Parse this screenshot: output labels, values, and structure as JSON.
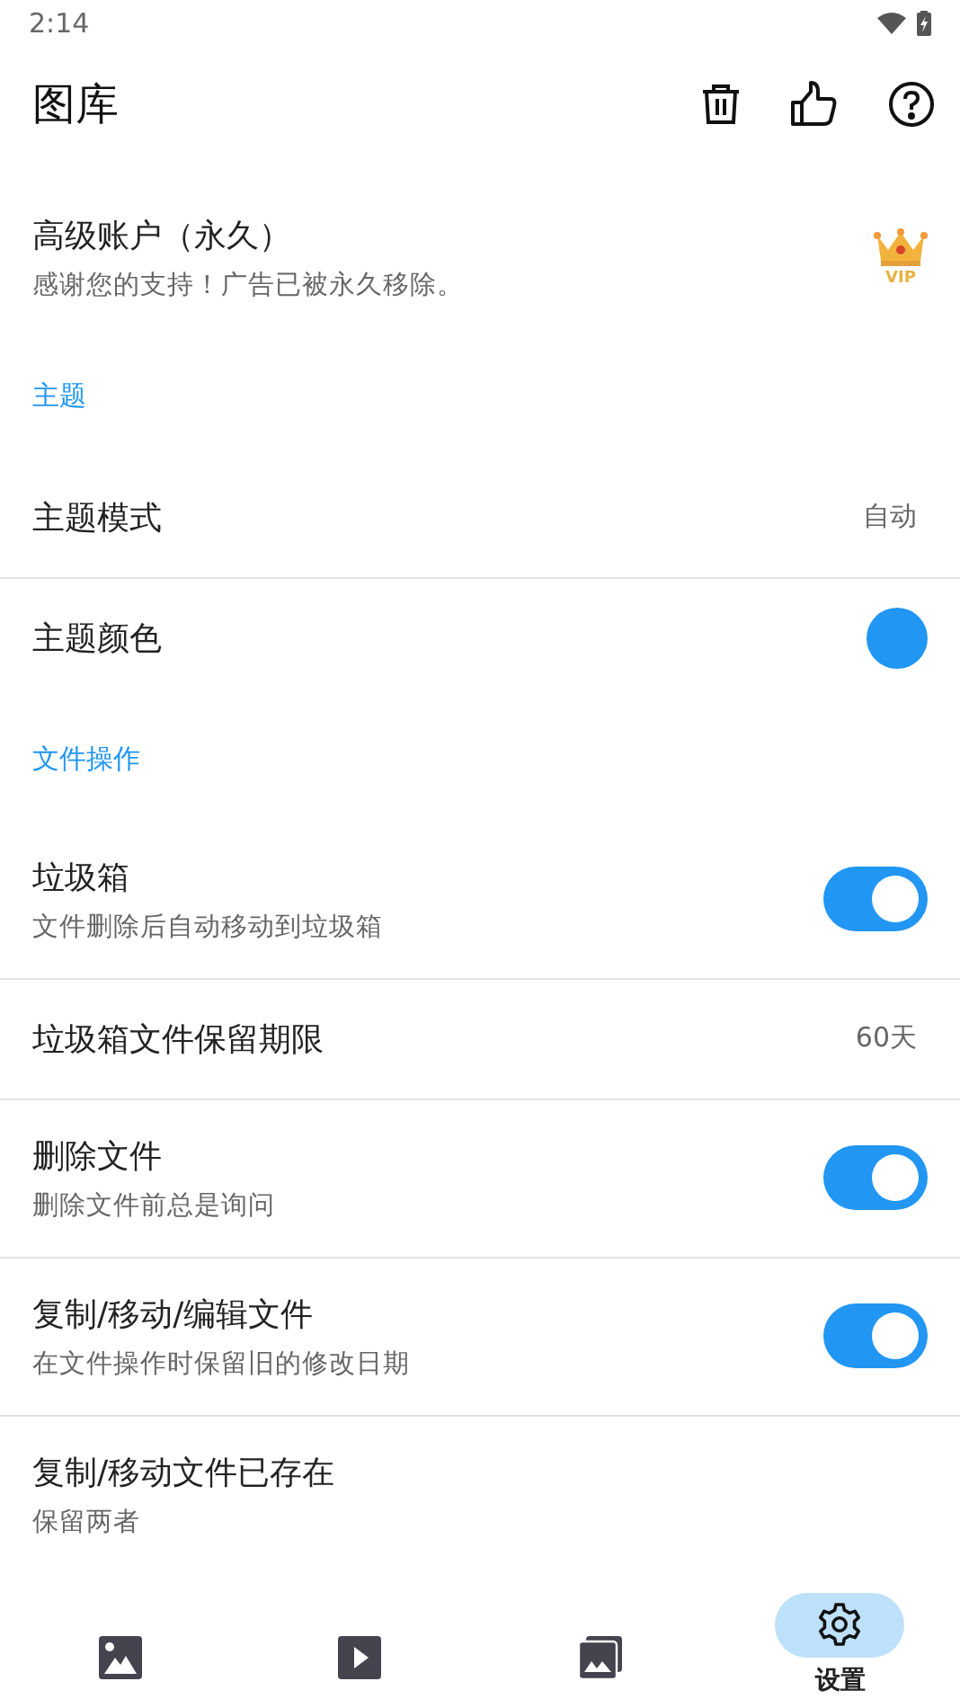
{
  "status_bar": {
    "time": "2:14"
  },
  "app_bar": {
    "title": "图库"
  },
  "rows": [
    {
      "kind": "premium",
      "title": "高级账户（永久）",
      "subtitle": "感谢您的支持！广告已被永久移除。",
      "badge": "VIP"
    },
    {
      "kind": "section",
      "title": "主题"
    },
    {
      "kind": "value",
      "title": "主题模式",
      "value": "自动"
    },
    {
      "kind": "color",
      "title": "主题颜色",
      "color": "#2196f3"
    },
    {
      "kind": "section",
      "title": "文件操作"
    },
    {
      "kind": "toggle",
      "title": "垃圾箱",
      "subtitle": "文件删除后自动移动到垃圾箱",
      "on": true
    },
    {
      "kind": "value",
      "title": "垃圾箱文件保留期限",
      "value": "60天"
    },
    {
      "kind": "toggle",
      "title": "删除文件",
      "subtitle": "删除文件前总是询问",
      "on": true
    },
    {
      "kind": "toggle",
      "title": "复制/移动/编辑文件",
      "subtitle": "在文件操作时保留旧的修改日期",
      "on": true
    },
    {
      "kind": "text",
      "title": "复制/移动文件已存在",
      "subtitle": "保留两者"
    }
  ],
  "bottom_nav": [
    {
      "kind": "photo",
      "selected": false
    },
    {
      "kind": "video",
      "selected": false
    },
    {
      "kind": "album",
      "selected": false
    },
    {
      "kind": "settings",
      "label": "设置",
      "selected": true
    }
  ]
}
